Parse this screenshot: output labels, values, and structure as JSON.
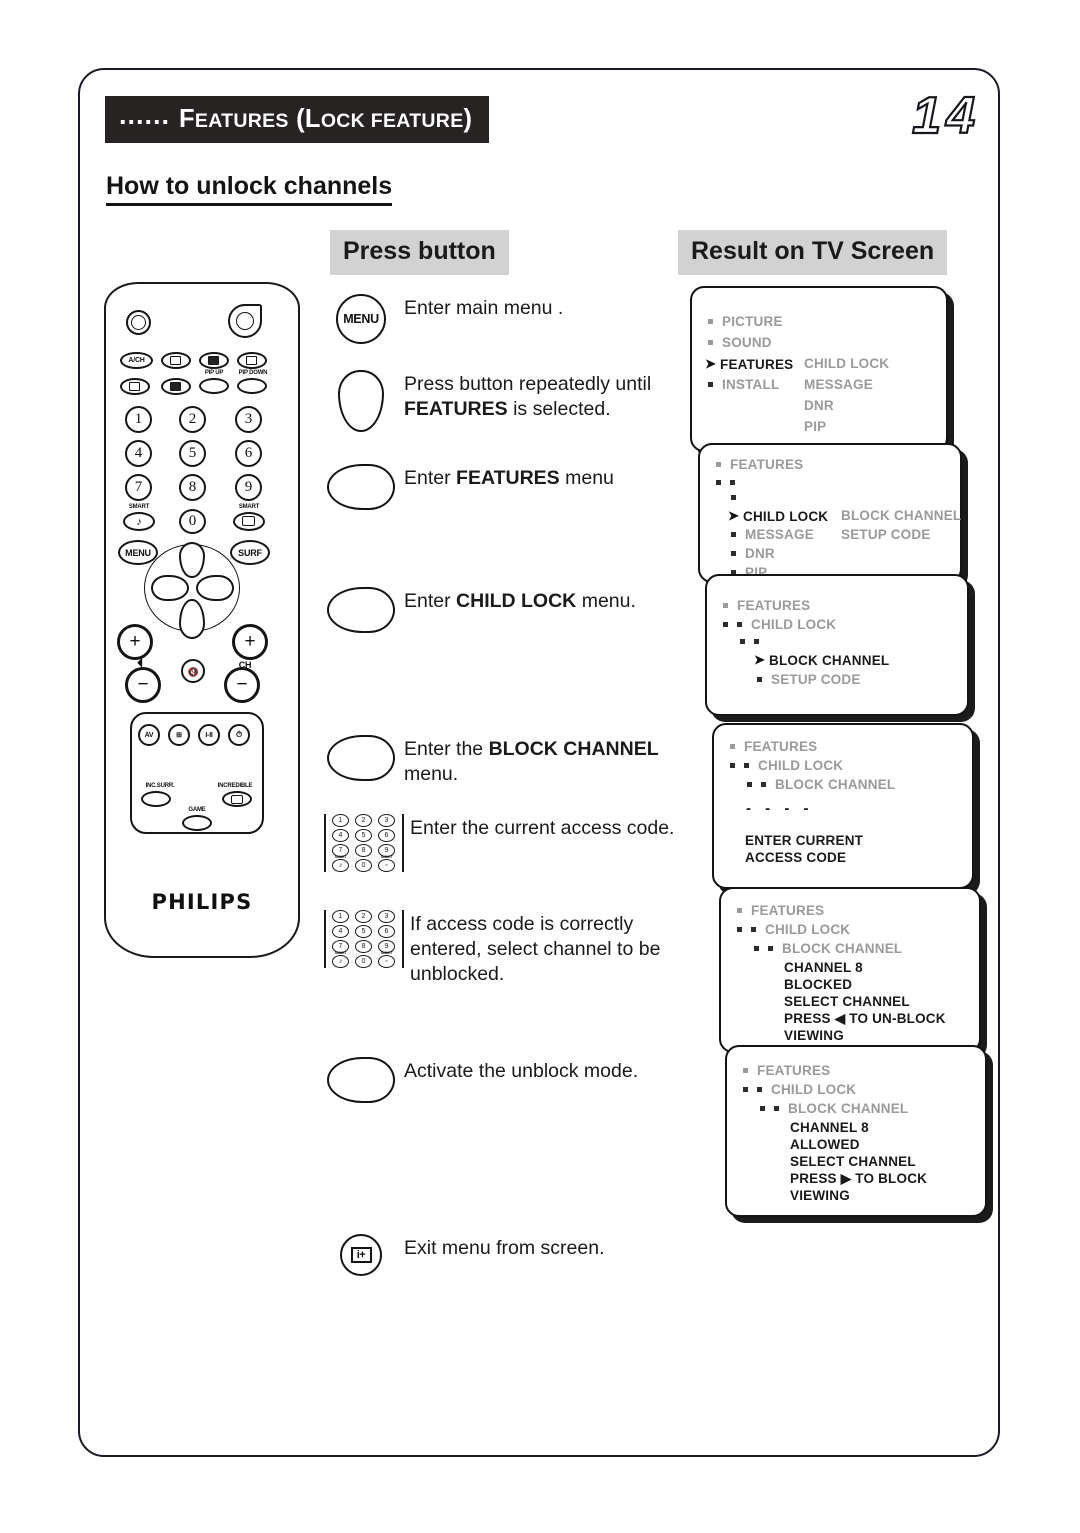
{
  "header": {
    "dots": "......",
    "title_parts": [
      {
        "text": "F",
        "caps": false
      },
      {
        "text": "EATURES",
        "caps": true
      },
      {
        "text": " (L",
        "caps": false
      },
      {
        "text": "OCK FEATURE",
        "caps": true
      },
      {
        "text": ")",
        "caps": false
      }
    ],
    "title_plain": "...... FEATURES (LOCK FEATURE)",
    "page_number": "14"
  },
  "subtitle": "How to unlock channels",
  "columns": {
    "press_button": "Press button",
    "result_on_tv": "Result on TV Screen"
  },
  "instructions": [
    {
      "icon": "menu-button-icon",
      "icon_label": "MENU",
      "text_html": "Enter main menu ."
    },
    {
      "icon": "cursor-down-teardrop-icon",
      "icon_label": "",
      "text_html": "Press button repeatedly until <b>FEATURES</b> is selected."
    },
    {
      "icon": "cursor-right-teardrop-icon",
      "icon_label": "",
      "text_html": "Enter <b>FEATURES</b> menu"
    },
    {
      "icon": "cursor-right-teardrop-icon",
      "icon_label": "",
      "text_html": "Enter <b>CHILD LOCK</b> menu."
    },
    {
      "icon": "cursor-right-teardrop-icon",
      "icon_label": "",
      "text_html": "Enter the <b>BLOCK CHANNEL</b> menu."
    },
    {
      "icon": "numeric-keypad-icon",
      "icon_label": "",
      "text_html": "Enter the current access code."
    },
    {
      "icon": "numeric-keypad-icon",
      "icon_label": "",
      "text_html": "If access code is correctly entered, select channel to be unblocked."
    },
    {
      "icon": "cursor-right-teardrop-icon",
      "icon_label": "",
      "text_html": "Activate the unblock mode."
    },
    {
      "icon": "info-plus-button-icon",
      "icon_label": "i+",
      "text_html": "Exit menu from screen."
    }
  ],
  "tv_panels": [
    {
      "name": "main-menu-panel",
      "rows": [
        {
          "indent": 0,
          "bullet": "gray",
          "label": "PICTURE",
          "style": "gray"
        },
        {
          "indent": 0,
          "bullet": "gray",
          "label": "SOUND",
          "style": "gray"
        },
        {
          "indent": 0,
          "bullet": "arrow",
          "label": "FEATURES",
          "style": "black",
          "right": "CHILD LOCK",
          "right_style": "gray"
        },
        {
          "indent": 0,
          "bullet": "dark",
          "label": "INSTALL",
          "style": "gray",
          "right": "MESSAGE",
          "right_style": "gray"
        },
        {
          "indent": 0,
          "bullet": "none",
          "label": "",
          "style": "gray",
          "right": "DNR",
          "right_style": "gray"
        },
        {
          "indent": 0,
          "bullet": "none",
          "label": "",
          "style": "gray",
          "right": "PIP",
          "right_style": "gray"
        }
      ]
    },
    {
      "name": "features-menu-panel",
      "rows": [
        {
          "indent": 0,
          "bullet": "gray",
          "label": "FEATURES",
          "style": "gray"
        },
        {
          "indent": 0,
          "bullet": "double",
          "label": "",
          "style": "gray"
        },
        {
          "indent": 1,
          "bullet": "dark",
          "label": "",
          "style": "gray"
        },
        {
          "indent": 1,
          "bullet": "arrow",
          "label": "CHILD LOCK",
          "style": "black",
          "right": "BLOCK CHANNEL",
          "right_style": "gray"
        },
        {
          "indent": 1,
          "bullet": "dark",
          "label": "MESSAGE",
          "style": "gray",
          "right": "SETUP CODE",
          "right_style": "gray"
        },
        {
          "indent": 1,
          "bullet": "dark",
          "label": "DNR",
          "style": "gray"
        },
        {
          "indent": 1,
          "bullet": "dark",
          "label": "PIP",
          "style": "gray"
        }
      ]
    },
    {
      "name": "child-lock-menu-panel",
      "rows": [
        {
          "indent": 0,
          "bullet": "gray",
          "label": "FEATURES",
          "style": "gray"
        },
        {
          "indent": 0,
          "bullet": "double",
          "label": "CHILD LOCK",
          "style": "gray"
        },
        {
          "indent": 1,
          "bullet": "double",
          "label": "",
          "style": "gray"
        },
        {
          "indent": 2,
          "bullet": "arrow",
          "label": "BLOCK CHANNEL",
          "style": "black"
        },
        {
          "indent": 2,
          "bullet": "dark",
          "label": "SETUP CODE",
          "style": "gray"
        }
      ]
    },
    {
      "name": "enter-access-code-panel",
      "rows": [
        {
          "indent": 0,
          "bullet": "gray",
          "label": "FEATURES",
          "style": "gray"
        },
        {
          "indent": 0,
          "bullet": "double",
          "label": "CHILD LOCK",
          "style": "gray"
        },
        {
          "indent": 1,
          "bullet": "double",
          "label": "BLOCK CHANNEL",
          "style": "gray"
        }
      ],
      "dashes": "- - - -",
      "message_lines": [
        "ENTER CURRENT",
        "ACCESS CODE"
      ]
    },
    {
      "name": "channel-blocked-panel",
      "rows": [
        {
          "indent": 0,
          "bullet": "gray",
          "label": "FEATURES",
          "style": "gray"
        },
        {
          "indent": 0,
          "bullet": "double",
          "label": "CHILD LOCK",
          "style": "gray"
        },
        {
          "indent": 1,
          "bullet": "double",
          "label": "BLOCK CHANNEL",
          "style": "gray"
        }
      ],
      "message_lines": [
        "CHANNEL 8",
        "BLOCKED",
        "SELECT CHANNEL",
        "PRESS ◀ TO UN-BLOCK",
        "VIEWING"
      ]
    },
    {
      "name": "channel-allowed-panel",
      "rows": [
        {
          "indent": 0,
          "bullet": "gray",
          "label": "FEATURES",
          "style": "gray"
        },
        {
          "indent": 0,
          "bullet": "double",
          "label": "CHILD LOCK",
          "style": "gray"
        },
        {
          "indent": 1,
          "bullet": "double",
          "label": "BLOCK CHANNEL",
          "style": "gray"
        }
      ],
      "message_lines": [
        "CHANNEL 8",
        "ALLOWED",
        "SELECT CHANNEL",
        "PRESS ▶ TO BLOCK",
        "VIEWING"
      ]
    }
  ],
  "remote": {
    "brand": "PHILIPS",
    "labels": {
      "a_ch": "A/CH",
      "pip_up": "PIP UP",
      "pip_down": "PIP DOWN",
      "smart_left": "SMART",
      "smart_right": "SMART",
      "menu": "MENU",
      "surf": "SURF",
      "ch": "CH",
      "av": "AV",
      "inc_surr": "INC.SURR.",
      "incredible": "INCREDIBLE",
      "game": "GAME"
    },
    "numbers": [
      "1",
      "2",
      "3",
      "4",
      "5",
      "6",
      "7",
      "8",
      "9",
      "0"
    ]
  },
  "colors": {
    "header_bar": "#262322",
    "column_head_bg": "#d2d2d2",
    "menu_gray_text": "#9a9a9a",
    "ink": "#1a1a1a"
  }
}
